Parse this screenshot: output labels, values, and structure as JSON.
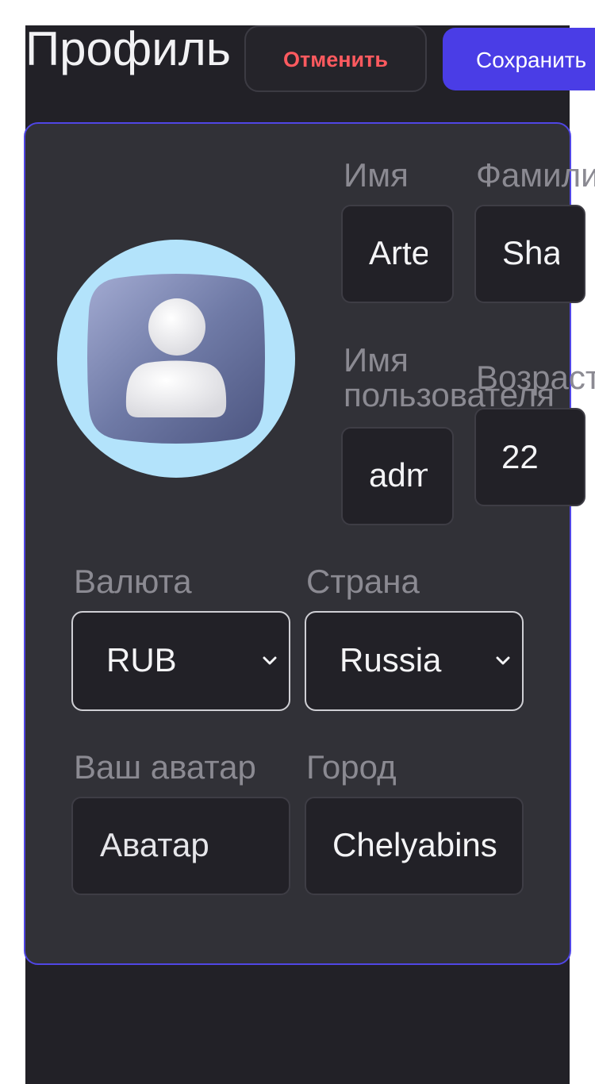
{
  "header": {
    "title": "Профиль",
    "cancel_label": "Отменить",
    "save_label": "Сохранить"
  },
  "profile": {
    "avatar_icon": "user-avatar-icon",
    "first_name": {
      "label": "Имя",
      "value": "Artem"
    },
    "last_name": {
      "label": "Фамилия",
      "value": "Sharapov"
    },
    "username": {
      "label": "Имя пользователя",
      "value": "admin"
    },
    "age": {
      "label": "Возраст",
      "value": "22"
    },
    "currency": {
      "label": "Валюта",
      "value": "RUB"
    },
    "country": {
      "label": "Страна",
      "value": "Russia"
    },
    "avatar_field": {
      "label": "Ваш аватар",
      "value": "Аватар"
    },
    "city": {
      "label": "Город",
      "value": "Chelyabinsk"
    }
  },
  "colors": {
    "background": "#222127",
    "card": "#313137",
    "accent": "#4a3de6",
    "danger": "#ff5a5f",
    "label": "#8b8a92"
  }
}
